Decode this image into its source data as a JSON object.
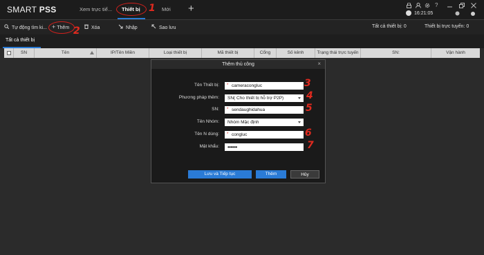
{
  "app": {
    "title_prefix": "SMART ",
    "title_bold": "PSS"
  },
  "tabs": [
    {
      "label": "Xem trực tiế..."
    },
    {
      "label": "Thiết bị"
    },
    {
      "label": "Mới"
    }
  ],
  "add_tab_symbol": "+",
  "system": {
    "icons": [
      "lock-icon",
      "user-icon",
      "settings-icon",
      "help-icon",
      "minimize-icon",
      "restore-icon",
      "close-icon"
    ],
    "time": "16:21:05"
  },
  "annotations": [
    "1",
    "2",
    "3",
    "4",
    "5",
    "6",
    "7"
  ],
  "toolbar": {
    "auto_search": "Tự động tìm ki...",
    "add": "Thêm",
    "delete": "Xóa",
    "import": "Nhập",
    "backup": "Sao lưu",
    "all_devices": "Tất cả thiết bị:  0",
    "online_devices": "Thiết bị trực tuyến:  0"
  },
  "subtab": "Tất cả thiết bị",
  "table_headers": [
    "SN",
    "Tên",
    "IP/Tên Miền",
    "Loại thiết bị",
    "Mã thiết bị",
    "Cổng",
    "Số kênh",
    "Trạng thái trực tuyến",
    "SN:",
    "Vận hành"
  ],
  "dialog": {
    "title": "Thêm thủ công",
    "close": "×",
    "fields": [
      {
        "label": "Tên Thiết bị:",
        "value": "cameracongluc"
      },
      {
        "label": "Phương pháp thêm:",
        "value": "SN( Cho thiết bị hỗ trợ P2P)"
      },
      {
        "label": "SN:",
        "value": "sendaughidahua"
      },
      {
        "label": "Tên Nhóm:",
        "value": "Nhóm Mặc định"
      },
      {
        "label": "Tên N dùng:",
        "value": "congluc"
      },
      {
        "label": "Mật khẩu:",
        "value": "••••••"
      }
    ],
    "buttons": {
      "save_continue": "Lưu và Tiếp tục",
      "add": "Thêm",
      "cancel": "Hủy"
    }
  },
  "colors": {
    "accent": "#2a7bd6",
    "annotation": "#e02a1f"
  }
}
